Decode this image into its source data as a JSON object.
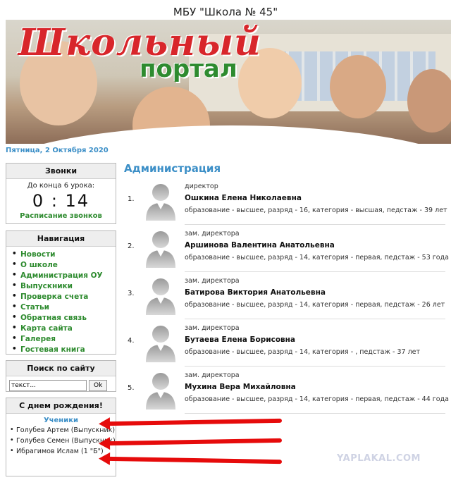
{
  "site": {
    "title": "МБУ \"Школа № 45\"",
    "logo_line1": "Школьный",
    "logo_line2": "портал",
    "date": "Пятница, 2 Октября 2020"
  },
  "bells": {
    "title": "Звонки",
    "countdown_label": "До конца 6 урока:",
    "timer": "0 : 14",
    "schedule_link": "Расписание звонков"
  },
  "nav": {
    "title": "Навигация",
    "items": [
      "Новости",
      "О школе",
      "Администрация ОУ",
      "Выпускники",
      "Проверка счета",
      "Статьи",
      "Обратная связь",
      "Карта сайта",
      "Галерея",
      "Гостевая книга"
    ]
  },
  "search": {
    "title": "Поиск по сайту",
    "value": "текст...",
    "button": "Ok"
  },
  "birthday": {
    "title": "С днем рождения!",
    "subtitle": "Ученики",
    "people": [
      "Голубев Артем (Выпускник)",
      "Голубев Семен (Выпускник)",
      "Ибрагимов Ислам (1 \"Б\")"
    ]
  },
  "admin": {
    "title": "Администрация",
    "staff": [
      {
        "num": "1.",
        "role": "директор",
        "name": "Ошкина Елена Николаевна",
        "details": "образование - высшее, разряд - 16, категория - высшая, педстаж - 39 лет"
      },
      {
        "num": "2.",
        "role": "зам. директора",
        "name": "Аршинова Валентина Анатольевна",
        "details": "образование - высшее, разряд - 14, категория - первая, педстаж - 53 года"
      },
      {
        "num": "3.",
        "role": "зам. директора",
        "name": "Батирова Виктория Анатольевна",
        "details": "образование - высшее, разряд - 14, категория - первая, педстаж - 26 лет"
      },
      {
        "num": "4.",
        "role": "зам. директора",
        "name": "Бутаева Елена Борисовна",
        "details": "образование - высшее, разряд - 14, категория - , педстаж - 37 лет"
      },
      {
        "num": "5.",
        "role": "зам. директора",
        "name": "Мухина Вера Михайловна",
        "details": "образование - высшее, разряд - 14, категория - первая, педстаж - 44 года"
      }
    ]
  },
  "watermark": "YAPLAKAL.COM",
  "colors": {
    "accent": "#3c8fc7",
    "link": "#2e8b2f",
    "logo_red": "#d8262b",
    "arrow": "#e60b0b"
  }
}
